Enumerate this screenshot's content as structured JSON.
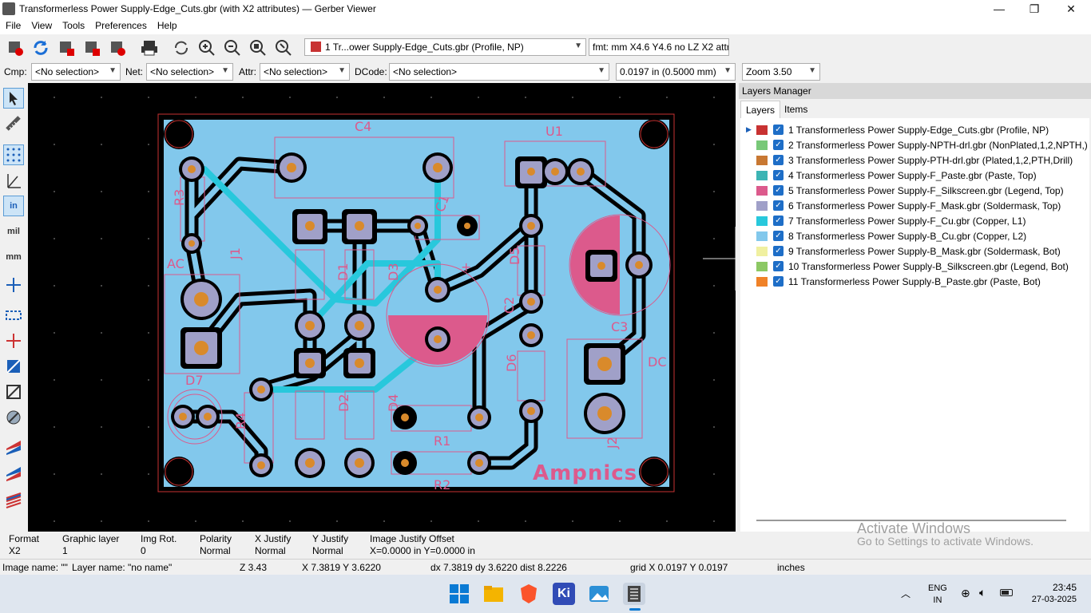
{
  "window": {
    "title": "Transformerless Power Supply-Edge_Cuts.gbr (with X2 attributes) — Gerber Viewer",
    "minimize": "—",
    "maximize": "❐",
    "close": "✕"
  },
  "menu": [
    "File",
    "View",
    "Tools",
    "Preferences",
    "Help"
  ],
  "toolbar": {
    "layer_select": "1 Tr...ower Supply-Edge_Cuts.gbr (Profile, NP)",
    "layer_select_color": "#c83232",
    "format_info": "fmt: mm X4.6 Y4.6 no LZ X2 attr"
  },
  "filters": {
    "cmp_label": "Cmp:",
    "cmp_value": "<No selection>",
    "net_label": "Net:",
    "net_value": "<No selection>",
    "attr_label": "Attr:",
    "attr_value": "<No selection>",
    "dcode_label": "DCode:",
    "dcode_value": "<No selection>",
    "grid_value": "0.0197 in (0.5000 mm)",
    "zoom_value": "Zoom 3.50"
  },
  "left_toolbar": {
    "mil_label": "mil",
    "mm_label": "mm",
    "in_label": "in"
  },
  "layers_manager": {
    "title": "Layers Manager",
    "tabs": [
      "Layers",
      "Items"
    ],
    "layers": [
      {
        "name": "1 Transformerless Power Supply-Edge_Cuts.gbr (Profile, NP)",
        "color": "#c83232"
      },
      {
        "name": "2 Transformerless Power Supply-NPTH-drl.gbr (NonPlated,1,2,NPTH,)",
        "color": "#78c878"
      },
      {
        "name": "3 Transformerless Power Supply-PTH-drl.gbr (Plated,1,2,PTH,Drill)",
        "color": "#c87832"
      },
      {
        "name": "4 Transformerless Power Supply-F_Paste.gbr (Paste, Top)",
        "color": "#3cb4b4"
      },
      {
        "name": "5 Transformerless Power Supply-F_Silkscreen.gbr (Legend, Top)",
        "color": "#dc5a8c"
      },
      {
        "name": "6 Transformerless Power Supply-F_Mask.gbr (Soldermask, Top)",
        "color": "#a0a0c8"
      },
      {
        "name": "7 Transformerless Power Supply-F_Cu.gbr (Copper, L1)",
        "color": "#28c8dc"
      },
      {
        "name": "8 Transformerless Power Supply-B_Cu.gbr (Copper, L2)",
        "color": "#82c8ec"
      },
      {
        "name": "9 Transformerless Power Supply-B_Mask.gbr (Soldermask, Bot)",
        "color": "#f0f0a0"
      },
      {
        "name": "10 Transformerless Power Supply-B_Silkscreen.gbr (Legend, Bot)",
        "color": "#8cc864"
      },
      {
        "name": "11 Transformerless Power Supply-B_Paste.gbr (Paste, Bot)",
        "color": "#f08228"
      }
    ]
  },
  "info": {
    "format_label": "Format",
    "format_value": "X2",
    "graphic_layer_label": "Graphic layer",
    "graphic_layer_value": "1",
    "img_rot_label": "Img Rot.",
    "img_rot_value": "0",
    "polarity_label": "Polarity",
    "polarity_value": "Normal",
    "xjustify_label": "X Justify",
    "xjustify_value": "Normal",
    "yjustify_label": "Y Justify",
    "yjustify_value": "Normal",
    "offset_label": "Image Justify Offset",
    "offset_value": "X=0.0000 in Y=0.0000 in"
  },
  "status": {
    "image_name": "Image name: \"\"",
    "layer_name": "Layer name: \"no name\"",
    "zoom": "Z 3.43",
    "coords": "X 7.3819  Y 3.6220",
    "delta": "dx 7.3819  dy 3.6220  dist 8.2226",
    "grid": "grid X 0.0197  Y 0.0197",
    "units": "inches"
  },
  "pcb_labels": {
    "c4": "C4",
    "u1": "U1",
    "r3": "R3",
    "c1": "C1",
    "ac": "AC",
    "j1": "J1",
    "d1": "D1",
    "d3": "D3",
    "d5": "D5",
    "c2": "C2",
    "c3": "C3",
    "d7": "D7",
    "dc": "DC",
    "d6": "D6",
    "d2": "D2",
    "d4": "D4",
    "r1": "R1",
    "r4": "R4",
    "j2": "J2",
    "r2": "R2",
    "brand": "Ampnics",
    "plus": "+"
  },
  "watermark": {
    "line1": "Activate Windows",
    "line2": "Go to Settings to activate Windows."
  },
  "tray": {
    "lang1": "ENG",
    "lang2": "IN",
    "time": "23:45",
    "date": "27-03-2025"
  }
}
